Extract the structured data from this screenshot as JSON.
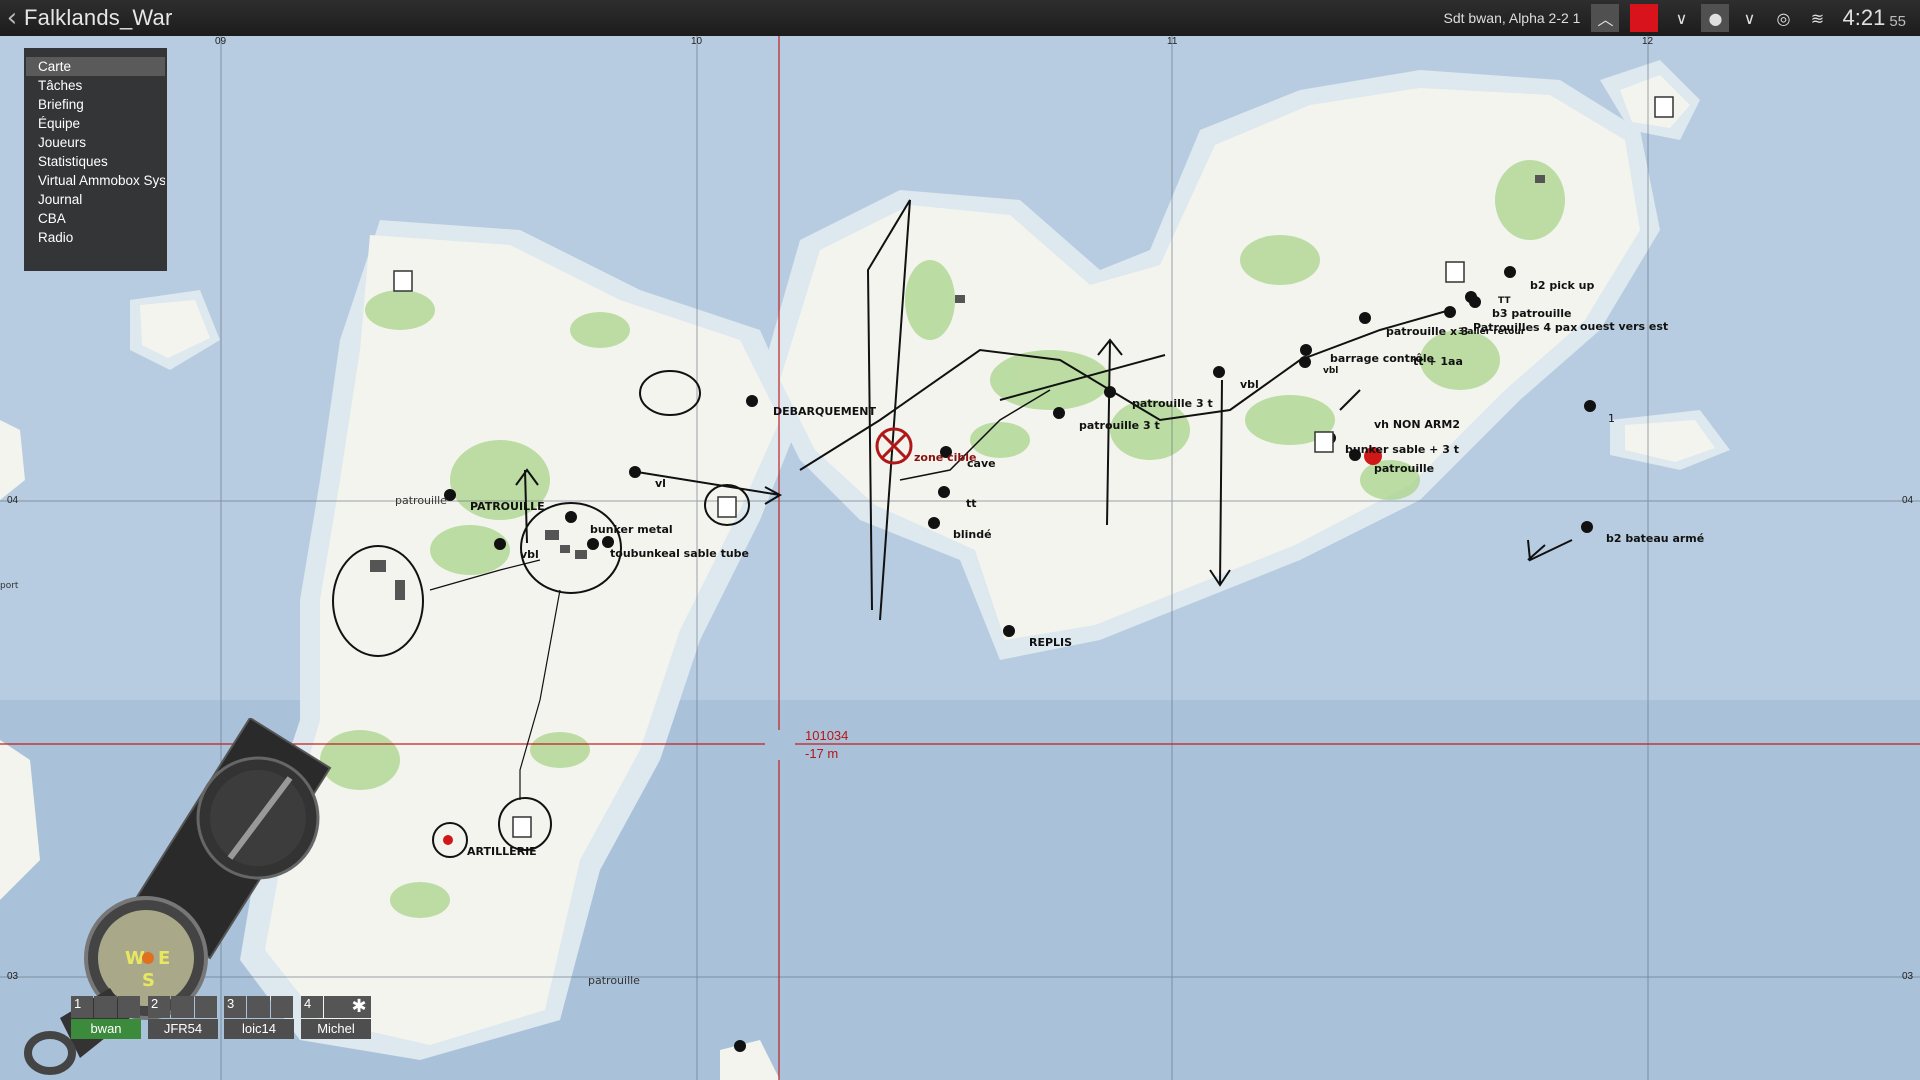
{
  "topbar": {
    "back_icon": "chevron-left-icon",
    "title": "Falklands_War",
    "player": "Sdt bwan, Alpha 2-2 1",
    "time": "4:21",
    "seconds": "55",
    "marker_color": "#d8131b"
  },
  "menu": {
    "items": [
      "Carte",
      "Tâches",
      "Briefing",
      "Équipe",
      "Joueurs",
      "Statistiques",
      "Virtual Ammobox System",
      "Journal",
      "CBA",
      "Radio"
    ],
    "active": "Carte"
  },
  "grid": {
    "top": [
      "09",
      "10",
      "11",
      "12"
    ],
    "left": [
      "04",
      "03"
    ],
    "right": [
      "04",
      "03"
    ]
  },
  "cursor": {
    "coord": "101034",
    "elevation": "-17 m"
  },
  "markers": {
    "debarquement": "DEBARQUEMENT",
    "patrouille_caps": "PATROUILLE",
    "patrouille": "patrouille",
    "vbl_west": "vbl",
    "bunker_metal": "bunker metal",
    "bunker_sable": "toubunkeal sable tube",
    "vl": "vl",
    "zone_cible": "zone cible",
    "cave": "cave",
    "tt": "tt",
    "blinde": "blindé",
    "replis": "REPLIS",
    "patrouille_3t_a": "patrouille 3 t",
    "patrouille_3t_b": "patrouille 3 t",
    "vbl_center": "vbl",
    "artillerie": "ARTILLERIE",
    "patrouille_south": "patrouille",
    "port": "port",
    "b2_pickup": "b2 pick up",
    "b3_patrouille": "b3 patrouille",
    "tt_east": "TT",
    "patrouille_x3": "patrouille x 3",
    "patrouilles_4pax": "Patrouilles 4 pax",
    "ouest_vers_est": "ouest vers est",
    "retour": "3 aller retour",
    "barrage": "barrage contrôle",
    "vbl_east": "vbl",
    "tt_1aa": "tt + 1aa",
    "vh_non_arm2": "vh NON ARM2",
    "bunker_sable_3t": "bunker sable + 3 t",
    "patrouille_east": "patrouille",
    "b2_bateau": "b2 bateau armé",
    "one": "1"
  },
  "squad": [
    {
      "num": "1",
      "name": "bwan",
      "selected": true
    },
    {
      "num": "2",
      "name": "JFR54",
      "selected": false
    },
    {
      "num": "3",
      "name": "loic14",
      "selected": false
    },
    {
      "num": "4",
      "name": "Michel",
      "selected": false
    }
  ],
  "squad_extra_icon": "asterisk-icon"
}
